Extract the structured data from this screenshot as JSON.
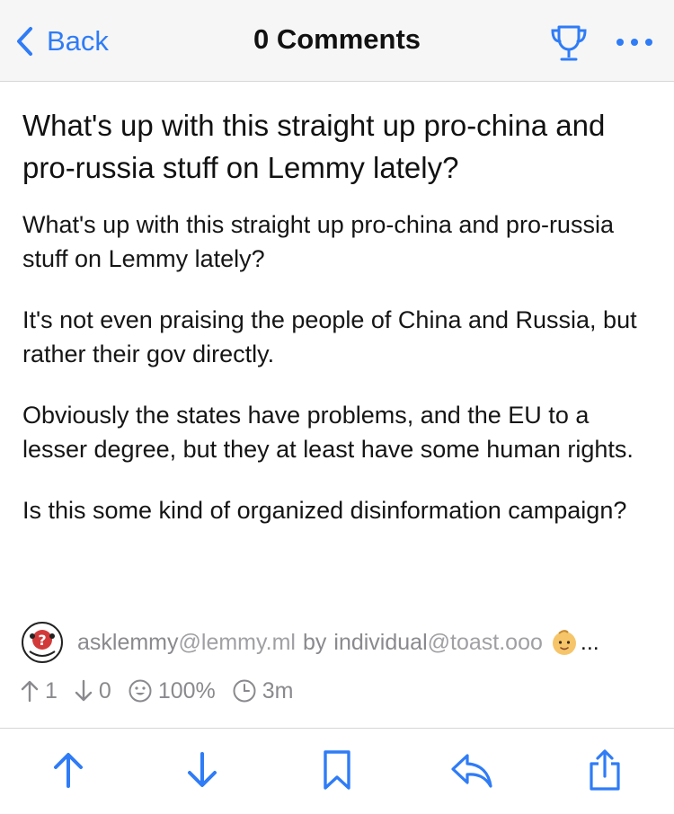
{
  "colors": {
    "accent": "#2f7cf6",
    "secondary_text": "#8a8a8e",
    "nav_background": "#f6f6f7"
  },
  "nav": {
    "back_label": "Back",
    "title": "0 Comments",
    "trophy_icon": "trophy-icon",
    "more_icon": "more-horizontal-icon"
  },
  "post": {
    "title": "What's up with this straight up pro-china and pro-russia stuff on Lemmy lately?",
    "body": [
      "What's up with this straight up pro-china and pro-russia stuff on Lemmy lately?",
      "It's not even praising the people of China and Russia, but rather their gov directly.",
      "Obviously the states have problems, and the EU to a lesser degree, but they at least have some human rights.",
      "Is this some kind of organized disinformation campaign?"
    ],
    "community": {
      "name": "asklemmy",
      "host": "@lemmy.ml",
      "avatar_icon": "question-mark-icon"
    },
    "by_label": "by",
    "author": {
      "name": "individual",
      "host": "@toast.ooo",
      "badge_icon": "baby-face-icon"
    },
    "more_label": "...",
    "stats": {
      "upvotes": "1",
      "downvotes": "0",
      "score_percent": "100%",
      "age": "3m"
    }
  },
  "toolbar": {
    "icons": [
      "upvote-icon",
      "downvote-icon",
      "bookmark-icon",
      "reply-icon",
      "share-icon"
    ]
  }
}
